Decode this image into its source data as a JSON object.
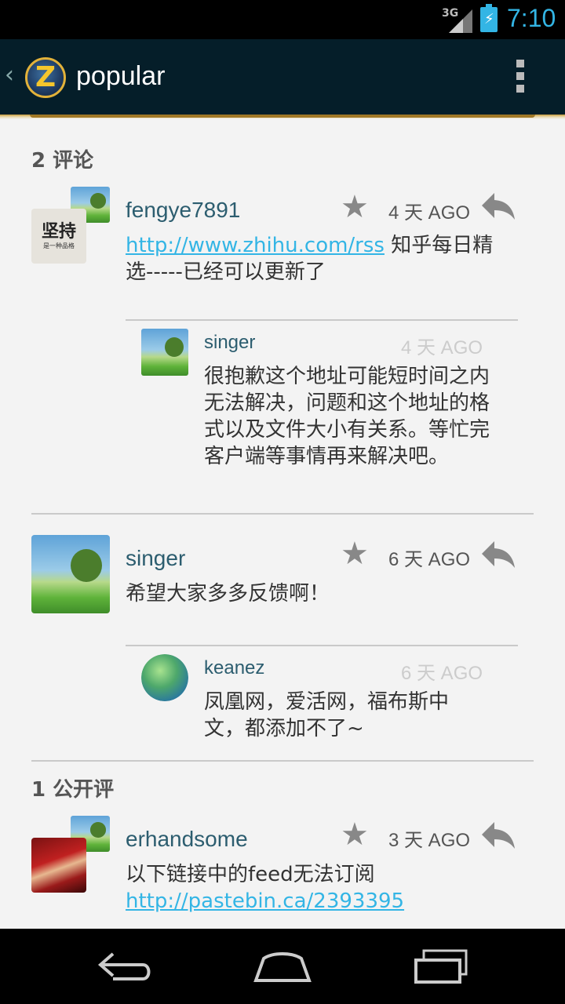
{
  "status_bar": {
    "network": "3G",
    "time": "7:10"
  },
  "action_bar": {
    "title": "popular",
    "logo_letter": "Z",
    "up_icon": "chevron-left-icon",
    "overflow_icon": "overflow-menu-icon"
  },
  "sections": [
    {
      "title": "2 评论"
    },
    {
      "title": "1 公开评"
    }
  ],
  "comments": [
    {
      "username": "fengye7891",
      "time": "4 天 AGO",
      "link": "http://www.zhihu.com/rss",
      "text": " 知乎每日精选-----已经可以更新了",
      "avatar_text": "坚持",
      "avatar_subtext": "是一种品格",
      "reply": {
        "username": "singer",
        "time": "4 天 AGO",
        "text": "很抱歉这个地址可能短时间之内无法解决，问题和这个地址的格式以及文件大小有关系。等忙完客户端等事情再来解决吧。"
      }
    },
    {
      "username": "singer",
      "time": "6 天 AGO",
      "text": "希望大家多多反馈啊！",
      "reply": {
        "username": "keanez",
        "time": "6 天 AGO",
        "text": "凤凰网，爱活网，福布斯中文，都添加不了~"
      }
    },
    {
      "username": "erhandsome",
      "time": "3 天 AGO",
      "text": "以下链接中的feed无法订阅 ",
      "link": "http://pastebin.ca/2393395"
    }
  ],
  "icons": {
    "star": "star-icon",
    "reply": "reply-icon"
  },
  "colors": {
    "accent": "#33b5e5",
    "action_bar": "#051e29",
    "username": "#2c5d6f"
  }
}
